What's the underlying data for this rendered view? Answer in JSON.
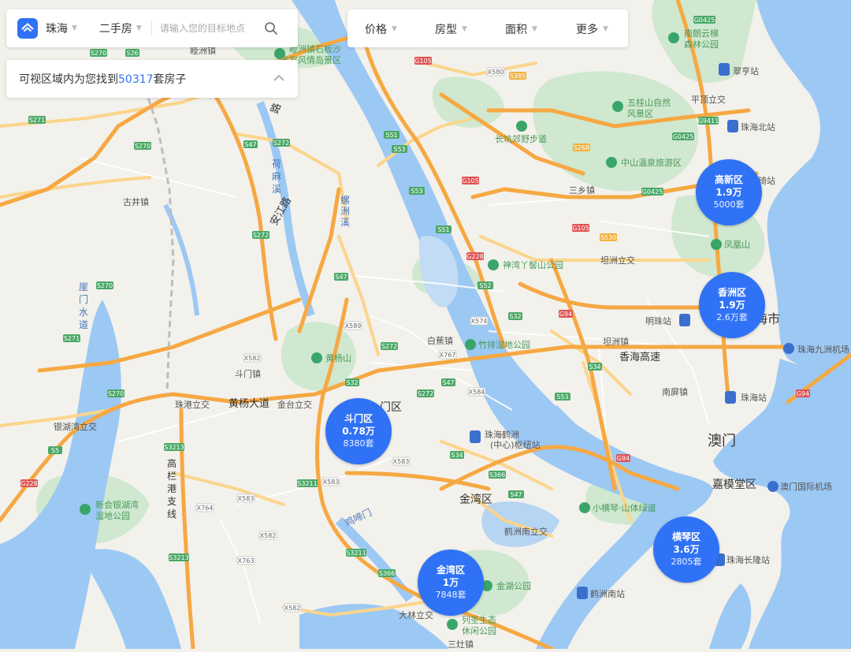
{
  "search_bar": {
    "city": "珠海",
    "type": "二手房",
    "placeholder": "请输入您的目标地点"
  },
  "result": {
    "prefix": "可视区域内为您找到",
    "count": "50317",
    "suffix": "套房子"
  },
  "filters": [
    {
      "label": "价格"
    },
    {
      "label": "房型"
    },
    {
      "label": "面积"
    },
    {
      "label": "更多"
    }
  ],
  "districts": [
    {
      "name": "高新区",
      "price": "1.9万",
      "count": "5000套"
    },
    {
      "name": "香洲区",
      "price": "1.9万",
      "count": "2.6万套"
    },
    {
      "name": "斗门区",
      "price": "0.78万",
      "count": "8380套"
    },
    {
      "name": "金湾区",
      "price": "1万",
      "count": "7848套"
    },
    {
      "name": "横琴区",
      "price": "3.6万",
      "count": "2805套"
    }
  ],
  "map_labels": {
    "places": [
      "睦洲镇",
      "古井镇",
      "斗门镇",
      "白蕉镇",
      "三乡镇",
      "坦洲立交",
      "坦洲镇",
      "南屏镇",
      "平顶立交",
      "珠港立交",
      "金台立交",
      "银湖湾立交",
      "大林立交",
      "三灶镇",
      "鹤洲南立交",
      "明珠站",
      "翠亨站",
      "珠海北站",
      "珠海站",
      "珠海鹤洲(中心)枢纽站",
      "鹤洲南站",
      "珠海长隆站",
      "金湾区",
      "澳门",
      "嘉模堂区",
      "珠海九洲机场",
      "澳门国际机场",
      "海市",
      "门区"
    ],
    "pois": [
      "五桂山自然风景区",
      "长坑郊野步道",
      "中山温泉旅游区",
      "神湾丫髻山公园",
      "竹排湿地公园",
      "黄杨山",
      "凤凰山",
      "南朗云梯森林公园",
      "新会银湖湾湿地公园",
      "金湖公园",
      "列圣生态休闲公园",
      "小横琴·山体绿道",
      "睦洲镇石板沙省级风景区"
    ],
    "roads": [
      "安江路",
      "黄杨大道",
      "香海高速",
      "荷麻溪",
      "螺洲溪",
      "崖门水道",
      "高栏港支线",
      "鸡啼门"
    ],
    "shields": [
      "S270",
      "S271",
      "S272",
      "S32",
      "S47",
      "S51",
      "S53",
      "S34",
      "S366",
      "G105",
      "G94",
      "G228",
      "G0425",
      "X580",
      "X589",
      "X582",
      "X583",
      "X584",
      "X574",
      "X767",
      "X763",
      "X764",
      "S3211",
      "S3213",
      "S5",
      "G9411",
      "S26"
    ]
  },
  "colors": {
    "accent": "#3072f6",
    "water": "#9cc8f4",
    "land": "#f3f1ec",
    "park": "#cfe8cf",
    "expressway": "#f6a843",
    "road": "#fbd58b"
  }
}
